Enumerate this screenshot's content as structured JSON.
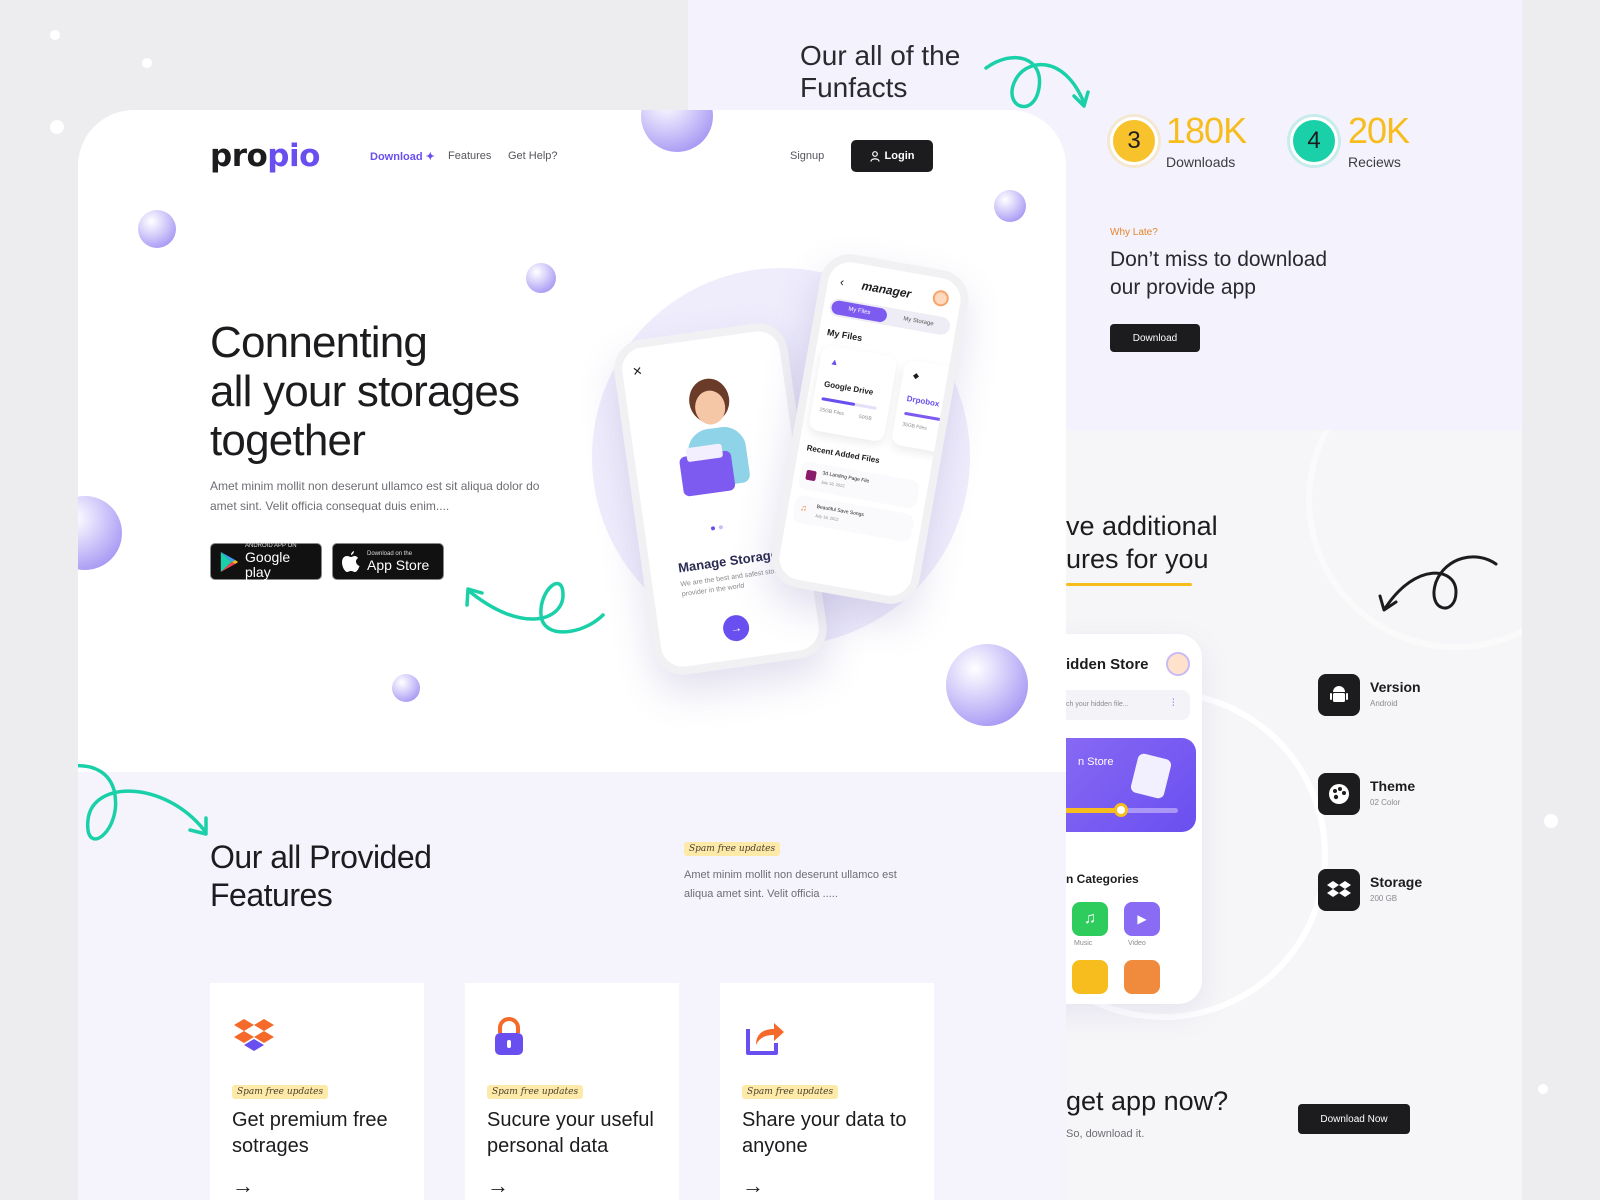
{
  "brand": {
    "logo_main": "pro",
    "logo_accent": "pio",
    "accent": "#6a4ff0",
    "highlight": "#f7bd1e",
    "teal": "#1ad0a8"
  },
  "nav": {
    "download": "Download",
    "features": "Features",
    "get_help": "Get Help?",
    "signup": "Signup",
    "login": "Login"
  },
  "hero": {
    "title_line1": "Connenting",
    "title_line2_a": "all your ",
    "title_line2_b": "storages",
    "title_line3": "together",
    "description": "Amet minim mollit non deserunt ullamco est sit aliqua dolor do amet sint. Velit officia consequat duis enim....",
    "google_small": "ANDROID APP ON",
    "google_big": "Google play",
    "apple_small": "Download on the",
    "apple_big": "App Store"
  },
  "phone_left": {
    "title": "Manage Storage",
    "desc": "We are the best and safest storage provider in the world"
  },
  "phone_right": {
    "title": "manager",
    "tab_files": "My Files",
    "tab_storage": "My Storage",
    "my_files": "My Files",
    "card1_name": "Google Drive",
    "card1_size": "50GB",
    "card1_used": "25GB Files",
    "card2_name": "Drpobox",
    "card2_used": "35GB Files",
    "recent": "Recent Added Files",
    "file1": "3d Landing Page File",
    "file1_date": "July 18, 2022",
    "file2": "Beautiful Save Songs",
    "file2_date": "July 18, 2022"
  },
  "features": {
    "title_line1": "Our all Provided",
    "title_line2": "Features",
    "tag": "Spam free updates",
    "description": "Amet minim mollit non deserunt ullamco est aliqua amet sint. Velit officia .....",
    "cards": [
      {
        "tag": "Spam free updates",
        "title": "Get premium free sotrages",
        "arrow": "→"
      },
      {
        "tag": "Spam free updates",
        "title": "Sucure your useful personal data",
        "arrow": "→"
      },
      {
        "tag": "Spam free updates",
        "title": "Share your data to anyone",
        "arrow": "→"
      }
    ]
  },
  "funfacts": {
    "title_line1": "Our all of the",
    "title_line2": "Funfacts",
    "stat1_badge": "3",
    "stat1_value": "180K",
    "stat1_label": "Downloads",
    "stat2_badge": "4",
    "stat2_value": "20K",
    "stat2_label": "Reciews"
  },
  "cta": {
    "eyebrow": "Why Late?",
    "title_line1": "Don’t miss to download",
    "title_line2": "our provide app",
    "button": "Download"
  },
  "additional": {
    "title_line1": "ve additional",
    "title_line2": "ures for you"
  },
  "side_phone": {
    "title": "idden Store",
    "search_placeholder": "ch your hidden file...",
    "banner": "n Store",
    "categories": "n Categories",
    "cat_music": "Music",
    "cat_video": "Video"
  },
  "specs": [
    {
      "title": "Version",
      "sub": "Android"
    },
    {
      "title": "Theme",
      "sub": "02 Color"
    },
    {
      "title": "Storage",
      "sub": "200 GB"
    }
  ],
  "bottom_cta": {
    "title": "get app now?",
    "sub": "So, download it.",
    "button": "Download Now"
  }
}
